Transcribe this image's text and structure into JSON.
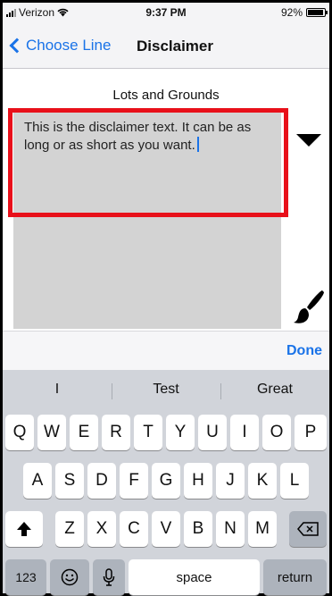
{
  "status_bar": {
    "carrier": "Verizon",
    "time": "9:37 PM",
    "battery": "92%"
  },
  "nav": {
    "back_label": "Choose Line",
    "title": "Disclaimer"
  },
  "content": {
    "section_title": "Lots and Grounds",
    "disclaimer_text": "This is the disclaimer text. It can be as long or as short as you want."
  },
  "accessory": {
    "done_label": "Done"
  },
  "keyboard": {
    "suggestions": [
      "I",
      "Test",
      "Great"
    ],
    "row1": [
      "Q",
      "W",
      "E",
      "R",
      "T",
      "Y",
      "U",
      "I",
      "O",
      "P"
    ],
    "row2": [
      "A",
      "S",
      "D",
      "F",
      "G",
      "H",
      "J",
      "K",
      "L"
    ],
    "row3": [
      "Z",
      "X",
      "C",
      "V",
      "B",
      "N",
      "M"
    ],
    "numbers_label": "123",
    "space_label": "space",
    "return_label": "return"
  },
  "colors": {
    "accent": "#1a73e8",
    "highlight": "#e8101a",
    "textarea_bg": "#d3d3d3",
    "keyboard_bg": "#d1d4da"
  }
}
